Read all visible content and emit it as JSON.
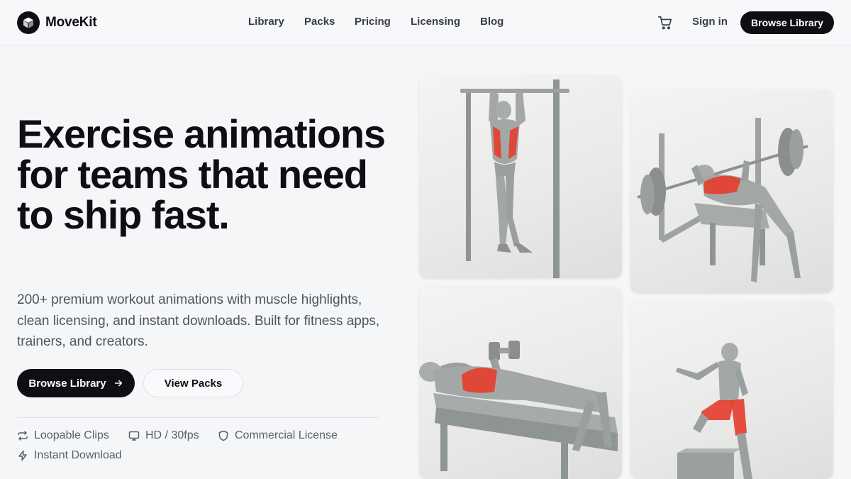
{
  "brand": {
    "name": "MoveKit"
  },
  "nav": {
    "items": [
      "Library",
      "Packs",
      "Pricing",
      "Licensing",
      "Blog"
    ]
  },
  "header": {
    "signin_label": "Sign in",
    "cta_label": "Browse Library"
  },
  "hero": {
    "headline": "Exercise animations for teams that need to ship fast.",
    "subtext": "200+ premium workout animations with muscle highlights, clean licensing, and instant downloads. Built for fitness apps, trainers, and creators.",
    "primary_cta": "Browse Library",
    "secondary_cta": "View Packs"
  },
  "features": [
    "Loopable Clips",
    "HD / 30fps",
    "Commercial License",
    "Instant Download"
  ],
  "icons": {
    "logo": "cube-icon",
    "cart": "shopping-cart-icon",
    "cta_arrow": "arrow-right-icon",
    "features": [
      "repeat-icon",
      "monitor-icon",
      "shield-icon",
      "lightning-icon"
    ]
  },
  "colors": {
    "accent_dark": "#0e0f12",
    "muscle_highlight": "#e53c2e",
    "background": "#f5f6f8"
  }
}
